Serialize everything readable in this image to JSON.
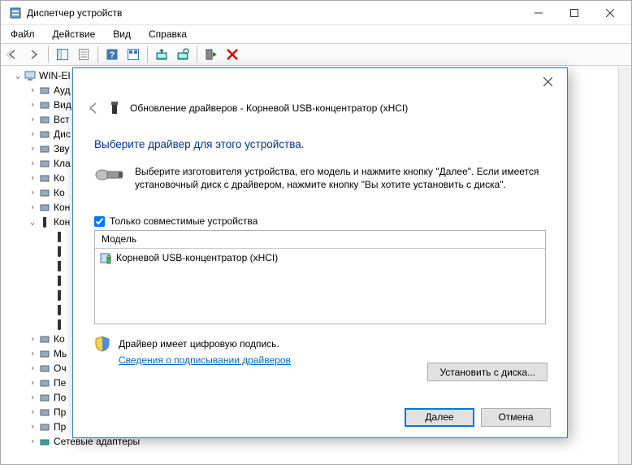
{
  "window": {
    "title": "Диспетчер устройств"
  },
  "menu": {
    "file": "Файл",
    "action": "Действие",
    "view": "Вид",
    "help": "Справка"
  },
  "tree": {
    "root": "WIN-EI",
    "items": [
      "Ауд",
      "Вид",
      "Вст",
      "Дис",
      "Зву",
      "Кла",
      "Ко",
      "Ко",
      "Кон"
    ],
    "usb_children_count": 7,
    "items2": [
      "Кo",
      "Мь",
      "Оч",
      "Пе",
      "По",
      "Пр",
      "Пр"
    ],
    "last": "Сетевые адаптеры"
  },
  "dialog": {
    "breadcrumb": "Обновление драйверов - Корневой USB-концентратор (xHCI)",
    "heading": "Выберите драйвер для этого устройства.",
    "instruction": "Выберите изготовителя устройства, его модель и нажмите кнопку \"Далее\". Если имеется установочный диск с  драйвером, нажмите кнопку \"Вы хотите установить с диска\".",
    "checkbox_label": "Только совместимые устройства",
    "model_header": "Модель",
    "model_item": "Корневой USB-концентратор (xHCI)",
    "signed_text": "Драйвер имеет цифровую подпись.",
    "signed_link": "Сведения о подписывании драйверов",
    "install_button": "Установить с диска...",
    "next": "Далее",
    "cancel": "Отмена"
  }
}
